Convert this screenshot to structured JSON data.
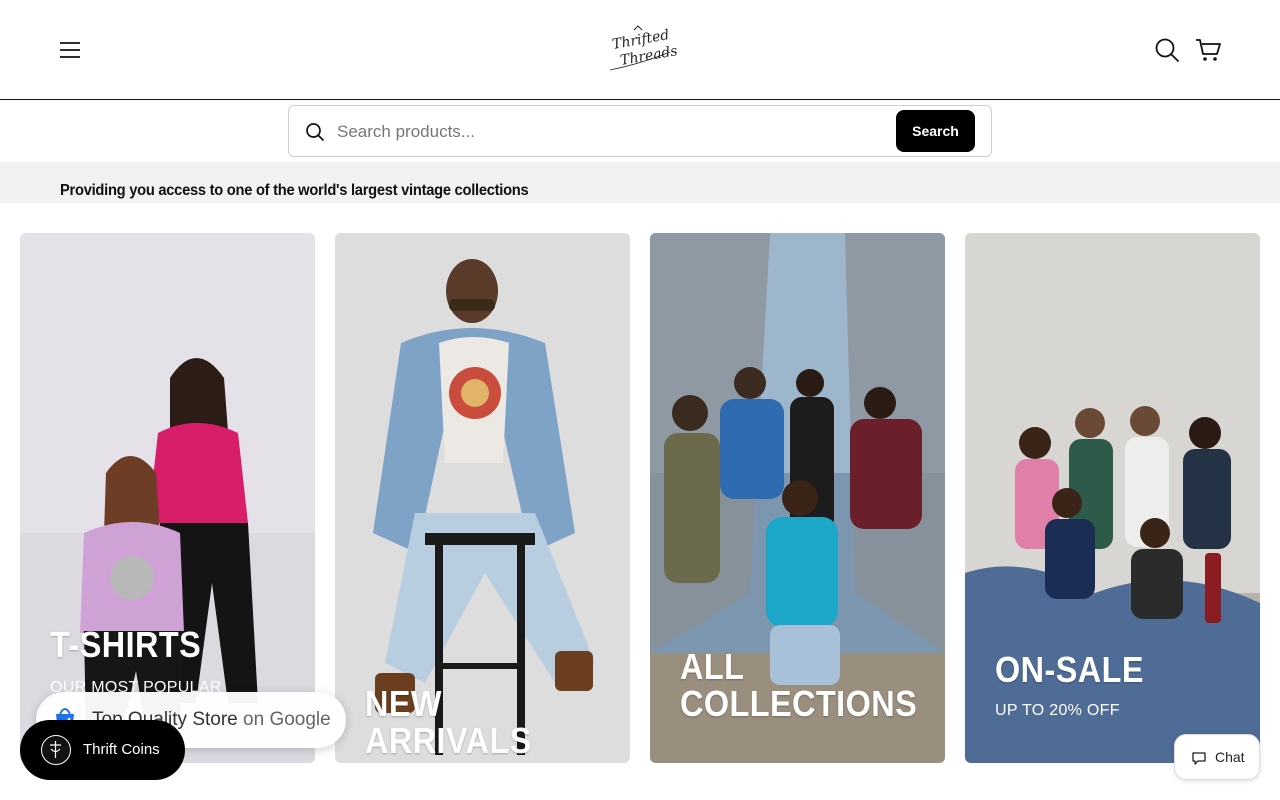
{
  "header": {
    "logo_line1": "Thrifted",
    "logo_line2": "Threads"
  },
  "search": {
    "placeholder": "Search products...",
    "button_label": "Search"
  },
  "announcement": {
    "text": "Providing you access to one of the world's largest vintage collections"
  },
  "cards": [
    {
      "title": "T-SHIRTS",
      "subtitle": "OUR MOST POPULAR"
    },
    {
      "title": "NEW ARRIVALS",
      "subtitle": ""
    },
    {
      "title": "ALL COLLECTIONS",
      "subtitle": ""
    },
    {
      "title": "ON-SALE",
      "subtitle": "UP TO 20% OFF"
    }
  ],
  "google_badge": {
    "label": "Top Quality Store",
    "suffix": "on Google"
  },
  "thrift_coins": {
    "label": "Thrift Coins"
  },
  "chat": {
    "label": "Chat"
  },
  "icons": {
    "menu": "hamburger-menu-icon",
    "search": "search-icon",
    "cart": "shopping-cart-icon",
    "chat": "chat-bubble-icon"
  },
  "colors": {
    "primary": "#000000",
    "announcement_bg": "#f2f2f2",
    "card_text": "#ffffff"
  }
}
